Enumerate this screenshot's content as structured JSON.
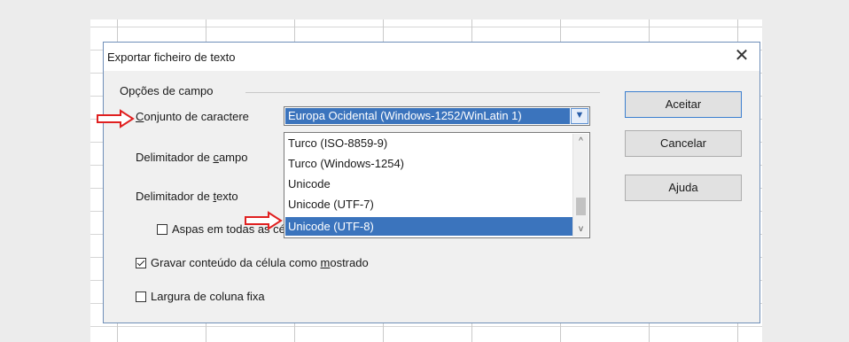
{
  "dialog": {
    "title": "Exportar ficheiro de texto",
    "close_glyph": "✕",
    "group_label": "Opções de campo",
    "charset_label_u": "C",
    "charset_label_rest": "onjunto de caractere",
    "charset_value": "Europa Ocidental (Windows-1252/WinLatin 1)",
    "field_delim_label_a": "Delimitador de ",
    "field_delim_label_u": "c",
    "field_delim_label_b": "ampo",
    "text_delim_label_a": "Delimitador de ",
    "text_delim_label_u": "t",
    "text_delim_label_b": "exto",
    "quote_all_label": "Aspas em todas as células de texto",
    "save_as_displayed_label_a": "Gravar conteúdo da célula como ",
    "save_as_displayed_label_u": "m",
    "save_as_displayed_label_b": "ostrado",
    "save_as_displayed_checked": true,
    "fixed_width_label_a": "Lar",
    "fixed_width_label_u": "g",
    "fixed_width_label_b": "ura de coluna fixa",
    "fixed_width_checked": false,
    "quote_all_checked": false
  },
  "dropdown": {
    "options": [
      "Turco (ISO-8859-9)",
      "Turco (Windows-1254)",
      "Unicode",
      "Unicode (UTF-7)",
      "Unicode (UTF-8)"
    ],
    "selected_index": 4
  },
  "buttons": {
    "ok": "Aceitar",
    "cancel": "Cancelar",
    "help_a": "A",
    "help_u": "j",
    "help_b": "uda"
  },
  "colors": {
    "highlight": "#3b74bd",
    "annotation_arrow": "#e02020"
  },
  "icons": {
    "annotation": "red-arrow-icon",
    "dropdown": "chevron-down-icon",
    "scroll_up": "chevron-up-icon",
    "scroll_down": "chevron-down-icon"
  }
}
